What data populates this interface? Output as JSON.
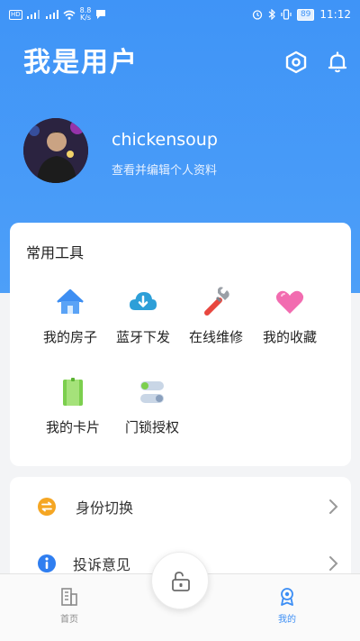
{
  "status_bar": {
    "network_badge": "HD",
    "speed_value": "8.8",
    "speed_unit": "K/s",
    "battery": "89",
    "time": "11:12"
  },
  "header": {
    "title": "我是用户",
    "settings_icon": "settings-hex-icon",
    "bell_icon": "bell-icon"
  },
  "profile": {
    "username": "chickensoup",
    "edit_link": "查看并编辑个人资料"
  },
  "tools": {
    "title": "常用工具",
    "items": [
      {
        "label": "我的房子",
        "icon": "house-icon",
        "color": "#3d8ef2"
      },
      {
        "label": "蓝牙下发",
        "icon": "cloud-download-icon",
        "color": "#2d9fd8"
      },
      {
        "label": "在线维修",
        "icon": "wrench-icon",
        "color": "#e8473f"
      },
      {
        "label": "我的收藏",
        "icon": "heart-icon",
        "color": "#f26cb0"
      },
      {
        "label": "我的卡片",
        "icon": "card-icon",
        "color": "#7ccf4e"
      },
      {
        "label": "门锁授权",
        "icon": "toggle-icon",
        "color": "#9bb0c8"
      }
    ]
  },
  "menu": {
    "items": [
      {
        "label": "身份切换",
        "icon": "swap-icon",
        "color": "#f5a623"
      },
      {
        "label": "投诉意见",
        "icon": "info-icon",
        "color": "#2f7ef0"
      }
    ]
  },
  "tabbar": {
    "home_label": "首页",
    "mine_label": "我的",
    "active_color": "#3c8ef5",
    "inactive_color": "#8b8b8b"
  }
}
